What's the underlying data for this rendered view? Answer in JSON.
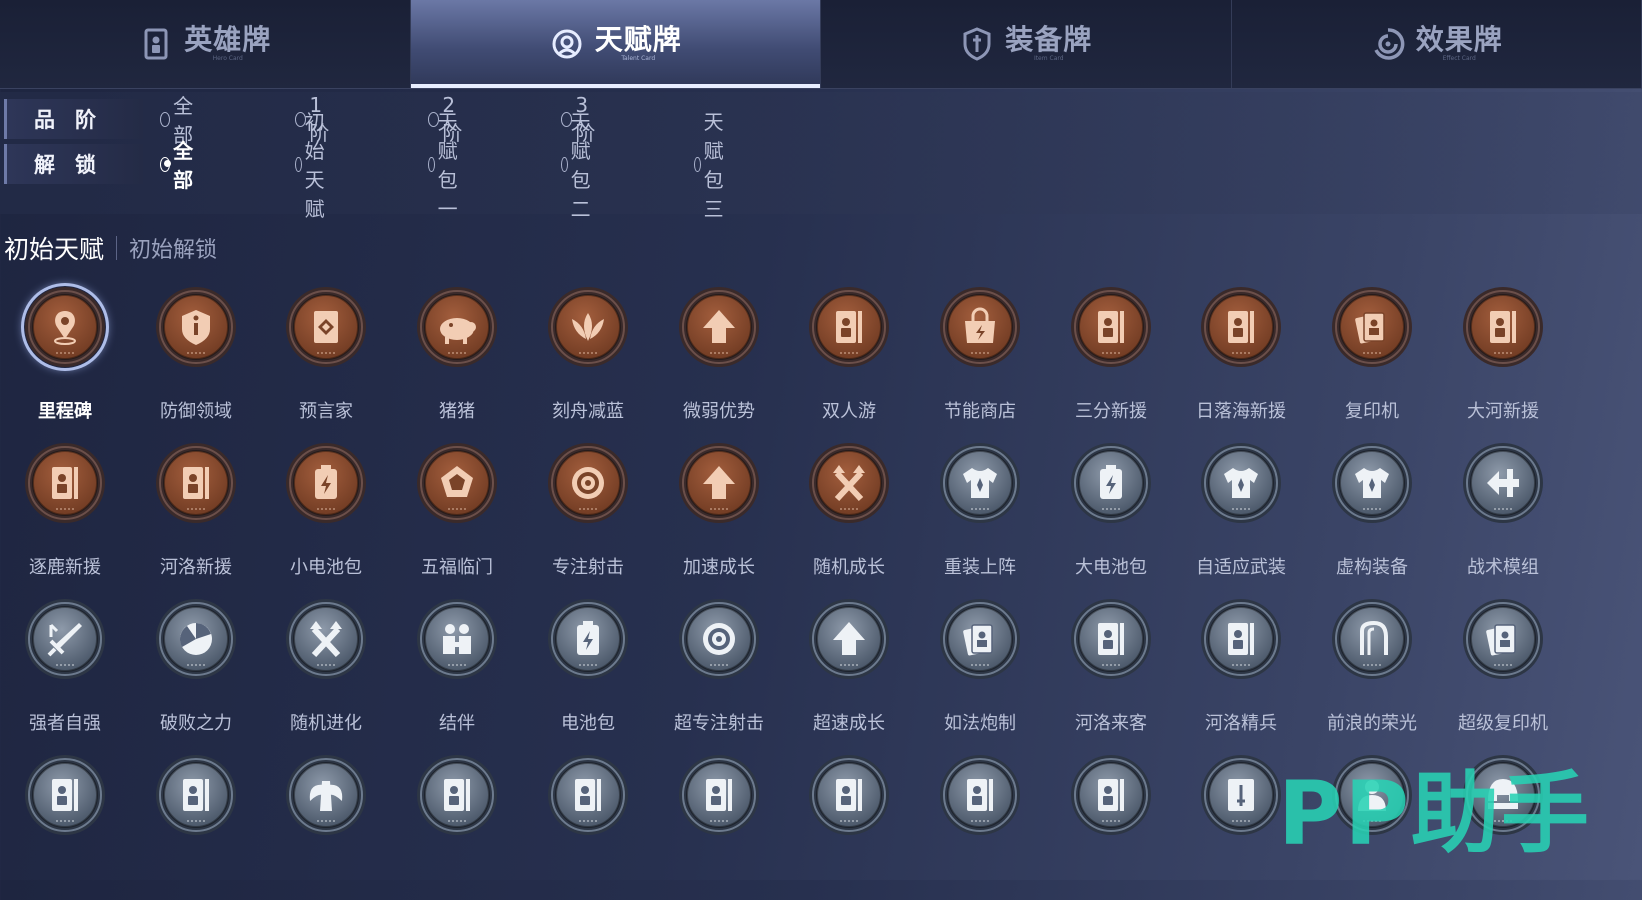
{
  "tabs": [
    {
      "label": "英雄牌",
      "sub": "Hero Card",
      "icon": "hero-card-icon",
      "active": false
    },
    {
      "label": "天赋牌",
      "sub": "Talent Card",
      "icon": "talent-card-icon",
      "active": true
    },
    {
      "label": "装备牌",
      "sub": "Item Card",
      "icon": "equipment-card-icon",
      "active": false
    },
    {
      "label": "效果牌",
      "sub": "Effect Card",
      "icon": "effect-card-icon",
      "active": false
    }
  ],
  "filters": {
    "tier": {
      "label": "品阶",
      "options": [
        {
          "label": "全部",
          "selected": false
        },
        {
          "label": "1阶",
          "selected": false
        },
        {
          "label": "2阶",
          "selected": false
        },
        {
          "label": "3阶",
          "selected": false
        }
      ]
    },
    "unlock": {
      "label": "解锁",
      "options": [
        {
          "label": "全部",
          "selected": true
        },
        {
          "label": "初始天赋",
          "selected": false
        },
        {
          "label": "天赋包一",
          "selected": false
        },
        {
          "label": "天赋包二",
          "selected": false
        },
        {
          "label": "天赋包三",
          "selected": false
        }
      ]
    }
  },
  "section": {
    "title": "初始天赋",
    "subtitle": "初始解锁"
  },
  "colors": {
    "bronze": "#b8744f",
    "silver": "#9aa6b8",
    "accent": "#e8eeff",
    "watermark": "#28d2b4"
  },
  "cards": [
    {
      "name": "里程碑",
      "tier": "bronze",
      "icon": "map-pin-icon",
      "selected": true
    },
    {
      "name": "防御领域",
      "tier": "bronze",
      "icon": "shield-info-icon"
    },
    {
      "name": "预言家",
      "tier": "bronze",
      "icon": "card-diamond-icon"
    },
    {
      "name": "猪猪",
      "tier": "bronze",
      "icon": "pig-icon"
    },
    {
      "name": "刻舟减蓝",
      "tier": "bronze",
      "icon": "lotus-icon"
    },
    {
      "name": "微弱优势",
      "tier": "bronze",
      "icon": "arrow-up-icon"
    },
    {
      "name": "双人游",
      "tier": "bronze",
      "icon": "portrait-card-icon"
    },
    {
      "name": "节能商店",
      "tier": "bronze",
      "icon": "shop-bag-icon"
    },
    {
      "name": "三分新援",
      "tier": "bronze",
      "icon": "portrait-card-icon"
    },
    {
      "name": "日落海新援",
      "tier": "bronze",
      "icon": "portrait-card-icon"
    },
    {
      "name": "复印机",
      "tier": "bronze",
      "icon": "card-stack-icon"
    },
    {
      "name": "大河新援",
      "tier": "bronze",
      "icon": "portrait-card-icon"
    },
    {
      "name": "逐鹿新援",
      "tier": "bronze",
      "icon": "portrait-card-icon"
    },
    {
      "name": "河洛新援",
      "tier": "bronze",
      "icon": "portrait-card-icon"
    },
    {
      "name": "小电池包",
      "tier": "bronze",
      "icon": "battery-icon"
    },
    {
      "name": "五福临门",
      "tier": "bronze",
      "icon": "pentagon-icon"
    },
    {
      "name": "专注射击",
      "tier": "bronze",
      "icon": "target-icon"
    },
    {
      "name": "加速成长",
      "tier": "bronze",
      "icon": "arrow-up-icon"
    },
    {
      "name": "随机成长",
      "tier": "bronze",
      "icon": "shuffle-icon"
    },
    {
      "name": "重装上阵",
      "tier": "silver",
      "icon": "armor-icon"
    },
    {
      "name": "大电池包",
      "tier": "silver",
      "icon": "battery-icon"
    },
    {
      "name": "自适应武装",
      "tier": "silver",
      "icon": "armor-icon"
    },
    {
      "name": "虚构装备",
      "tier": "silver",
      "icon": "armor-icon"
    },
    {
      "name": "战术模组",
      "tier": "silver",
      "icon": "module-icon"
    },
    {
      "name": "强者自强",
      "tier": "silver",
      "icon": "sword-icon"
    },
    {
      "name": "破败之力",
      "tier": "silver",
      "icon": "pie-icon"
    },
    {
      "name": "随机进化",
      "tier": "silver",
      "icon": "shuffle-icon"
    },
    {
      "name": "结伴",
      "tier": "silver",
      "icon": "companions-icon"
    },
    {
      "name": "电池包",
      "tier": "silver",
      "icon": "battery-icon"
    },
    {
      "name": "超专注射击",
      "tier": "silver",
      "icon": "target-icon"
    },
    {
      "name": "超速成长",
      "tier": "silver",
      "icon": "arrow-up-icon"
    },
    {
      "name": "如法炮制",
      "tier": "silver",
      "icon": "card-stack-icon"
    },
    {
      "name": "河洛来客",
      "tier": "silver",
      "icon": "portrait-card-icon"
    },
    {
      "name": "河洛精兵",
      "tier": "silver",
      "icon": "portrait-card-icon"
    },
    {
      "name": "前浪的荣光",
      "tier": "silver",
      "icon": "profile-icon"
    },
    {
      "name": "超级复印机",
      "tier": "silver",
      "icon": "card-stack-icon"
    },
    {
      "name": "",
      "tier": "silver",
      "icon": "portrait-card-icon"
    },
    {
      "name": "",
      "tier": "silver",
      "icon": "portrait-card-icon"
    },
    {
      "name": "",
      "tier": "silver",
      "icon": "axe-icon"
    },
    {
      "name": "",
      "tier": "silver",
      "icon": "portrait-card-icon"
    },
    {
      "name": "",
      "tier": "silver",
      "icon": "portrait-card-icon"
    },
    {
      "name": "",
      "tier": "silver",
      "icon": "portrait-card-icon"
    },
    {
      "name": "",
      "tier": "silver",
      "icon": "portrait-card-icon"
    },
    {
      "name": "",
      "tier": "silver",
      "icon": "portrait-card-icon"
    },
    {
      "name": "",
      "tier": "silver",
      "icon": "portrait-card-icon"
    },
    {
      "name": "",
      "tier": "silver",
      "icon": "sword-card-icon"
    },
    {
      "name": "",
      "tier": "silver",
      "icon": "person-icon"
    },
    {
      "name": "",
      "tier": "silver",
      "icon": "helmet-icon"
    }
  ],
  "watermark": "PP助手"
}
